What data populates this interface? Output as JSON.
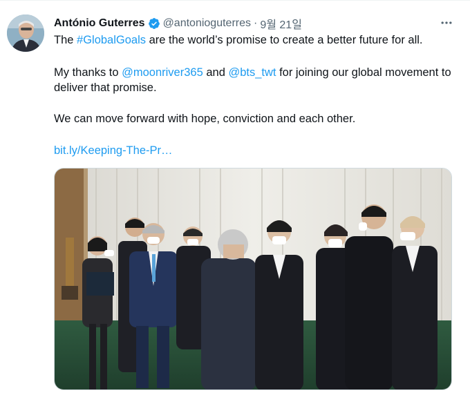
{
  "author": {
    "display_name": "António Guterres",
    "handle": "@antonioguterres",
    "separator": "·",
    "date": "9월 21일",
    "verified_icon": "verified-badge-icon",
    "avatar_icon": "profile-avatar"
  },
  "tweet": {
    "line1_pre": "The ",
    "hashtag": "#GlobalGoals",
    "line1_post": " are the world’s promise to create a better future for all.",
    "line2_pre": "My thanks to ",
    "mention1": "@moonriver365",
    "line2_mid": " and ",
    "mention2": "@bts_twt",
    "line2_post": " for joining our global movement to deliver that promise.",
    "line3": "We can move forward with hope, conviction and each other.",
    "link": "bit.ly/Keeping-The-Pr…"
  },
  "menu": {
    "icon": "more-options-icon"
  },
  "colors": {
    "link": "#1d9bf0",
    "text": "#0f1419",
    "muted": "#536471",
    "verified": "#1d9bf0"
  }
}
